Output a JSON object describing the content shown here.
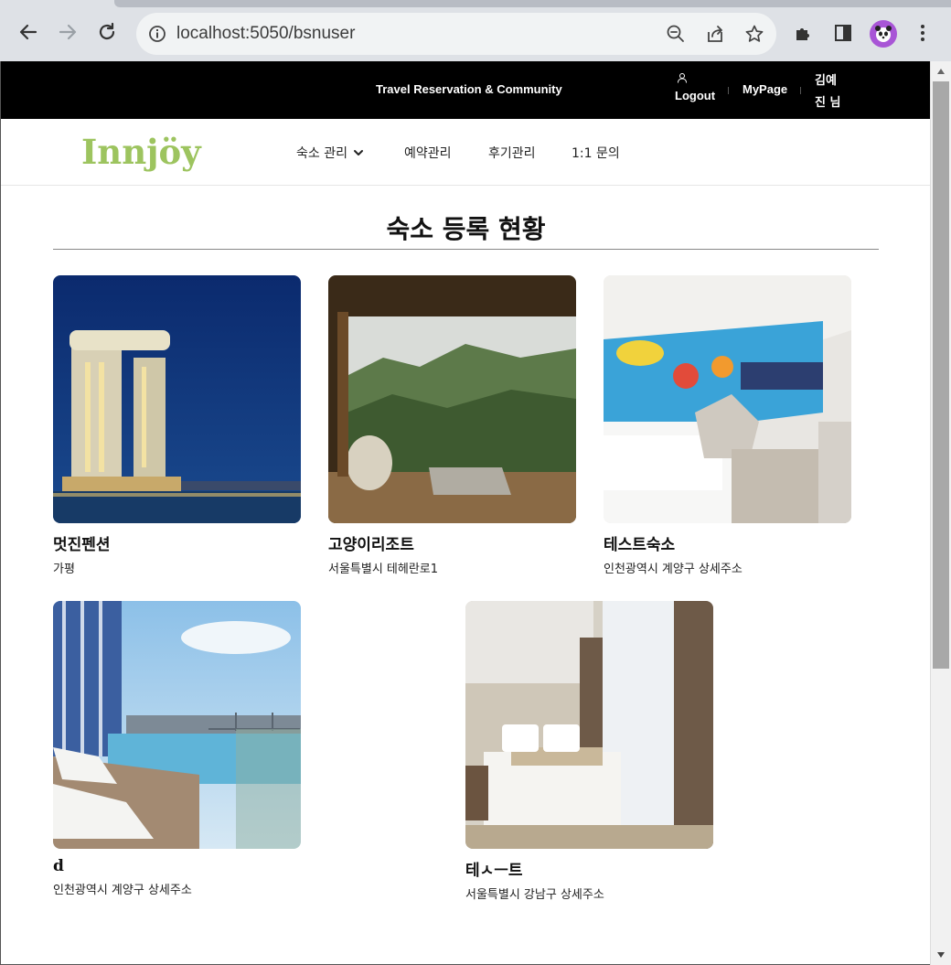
{
  "browser": {
    "url": "localhost:5050/bsnuser"
  },
  "topbar": {
    "tagline": "Travel Reservation & Community",
    "logout_label": "Logout",
    "mypage_label": "MyPage",
    "username_line1": "김예",
    "username_line2": "진 님"
  },
  "nav": {
    "logo": "Innjöy",
    "items": [
      {
        "label": "숙소 관리"
      },
      {
        "label": "예약관리"
      },
      {
        "label": "후기관리"
      },
      {
        "label": "1:1 문의"
      }
    ]
  },
  "main": {
    "title": "숙소 등록 현황",
    "cards": [
      {
        "name": "멋진펜션",
        "address": "가평"
      },
      {
        "name": "고양이리조트",
        "address": "서울특별시 테헤란로1"
      },
      {
        "name": "테스트숙소",
        "address": "인천광역시 계양구 상세주소"
      },
      {
        "name": "d",
        "address": "인천광역시 계양구 상세주소"
      },
      {
        "name": "테ㅅㅡ트",
        "address": "서울특별시 강남구 상세주소"
      }
    ]
  },
  "colors": {
    "topbar_bg": "#000000",
    "logo_green": "#9dc45f"
  }
}
